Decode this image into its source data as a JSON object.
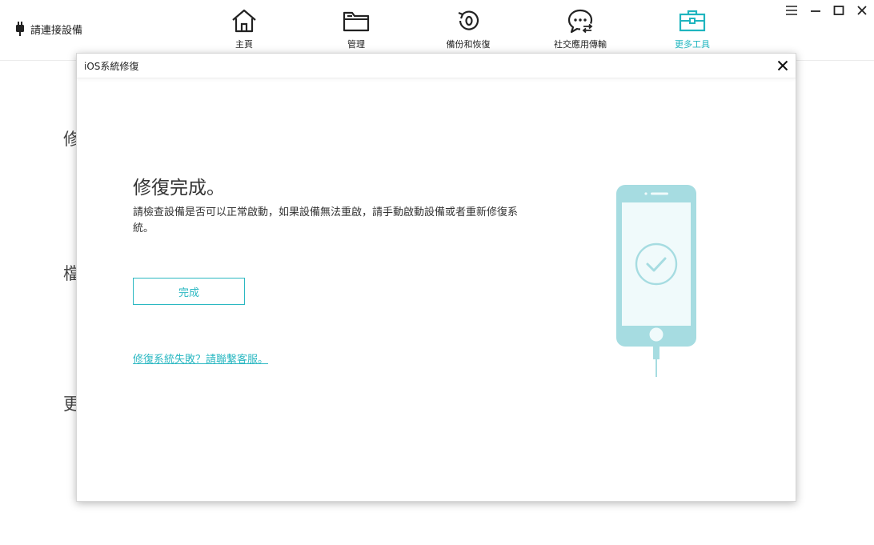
{
  "topbar": {
    "device_status": "請連接設備",
    "nav": [
      {
        "label": "主頁",
        "icon": "home-icon"
      },
      {
        "label": "管理",
        "icon": "folder-icon"
      },
      {
        "label": "備份和恢復",
        "icon": "backup-restore-icon"
      },
      {
        "label": "社交應用傳輸",
        "icon": "chat-transfer-icon"
      },
      {
        "label": "更多工具",
        "icon": "toolbox-icon",
        "active": true
      }
    ],
    "window_controls": [
      "menu-icon",
      "minimize-icon",
      "maximize-icon",
      "close-icon"
    ]
  },
  "background": {
    "heading_fragments": [
      "修",
      "檔",
      "更"
    ]
  },
  "modal": {
    "title": "iOS系統修復",
    "result_title": "修復完成。",
    "result_description": "請檢查設備是否可以正常啟動，如果設備無法重啟，請手動啟動設備或者重新修復系統。",
    "done_button": "完成",
    "support_link": "修復系統失敗？請聯繫客服。",
    "illustration": "phone-check-icon"
  },
  "colors": {
    "accent": "#2bb8c2",
    "active_nav": "#1fb5bf",
    "phone_body": "#a6dce1",
    "phone_screen": "#f0fafb"
  }
}
